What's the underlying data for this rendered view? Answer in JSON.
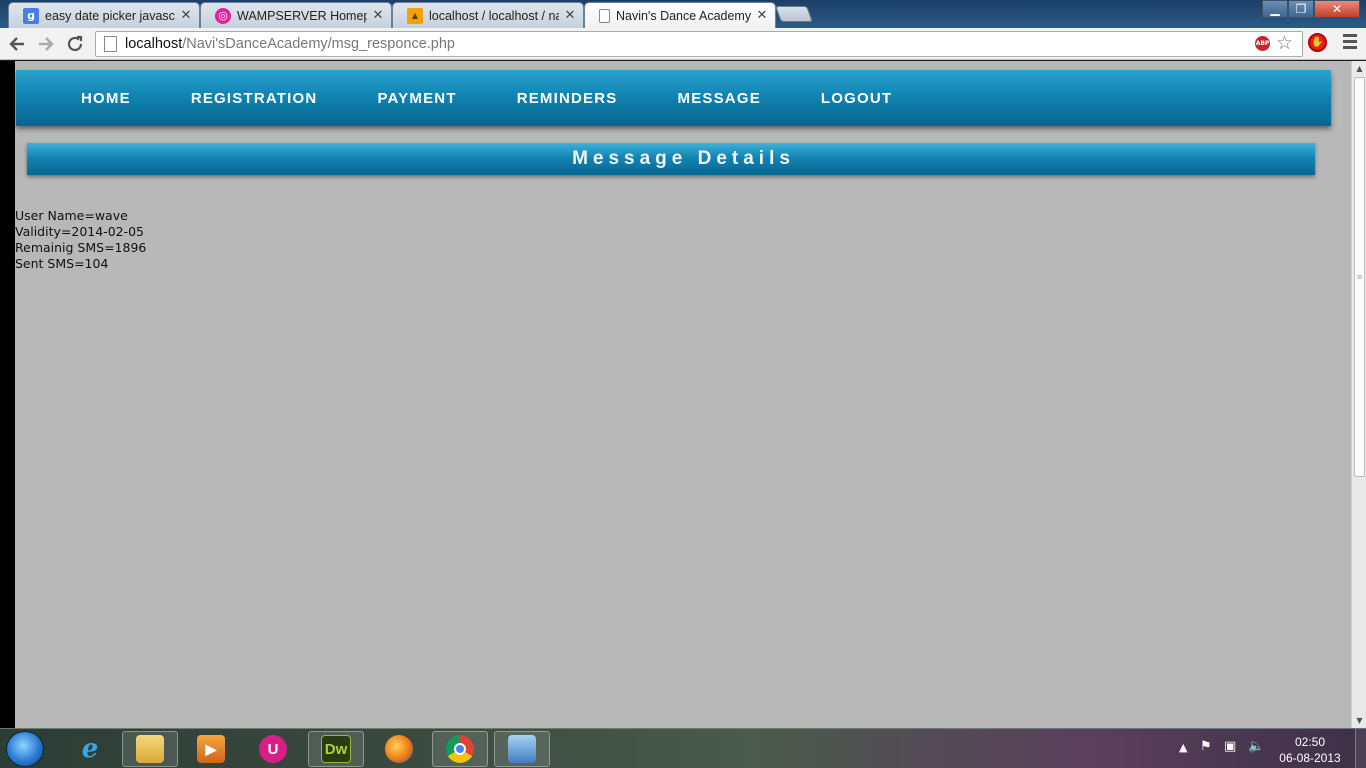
{
  "browser": {
    "tabs": [
      {
        "title": "easy date picker javascript",
        "favicon": "google-g",
        "active": false
      },
      {
        "title": "WAMPSERVER Homepage",
        "favicon": "wamp-logo",
        "active": false
      },
      {
        "title": "localhost / localhost / navi",
        "favicon": "phpmyadmin-logo",
        "active": false
      },
      {
        "title": "Navin's Dance Academy",
        "favicon": "page-icon",
        "active": true
      }
    ],
    "address": {
      "host": "localhost",
      "path": "/Navi'sDanceAcademy/msg_responce.php"
    },
    "extensions": {
      "adblock_label": "ABP"
    }
  },
  "site": {
    "nav": [
      "HOME",
      "REGISTRATION",
      "PAYMENT",
      "REMINDERS",
      "MESSAGE",
      "LOGOUT"
    ],
    "page_title": "Message Details",
    "details": [
      "User Name=wave",
      "Validity=2014-02-05",
      "Remainig SMS=1896",
      "Sent SMS=104"
    ]
  },
  "taskbar": {
    "apps": [
      "internet-explorer",
      "windows-explorer",
      "media-player",
      "uc-app",
      "dreamweaver",
      "firefox",
      "chrome",
      "control-panel"
    ],
    "dreamweaver_label": "Dw",
    "clock_time": "02:50",
    "clock_date": "06-08-2013"
  },
  "colors": {
    "nav_blue": "#1284b3",
    "page_bg": "#b8b8b8"
  }
}
